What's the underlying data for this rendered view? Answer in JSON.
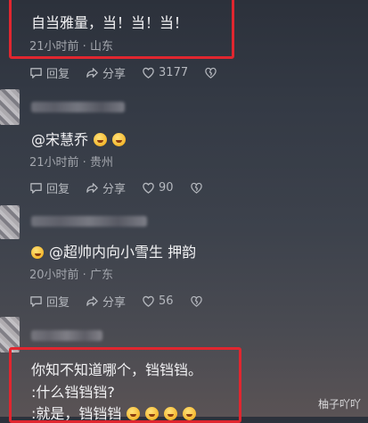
{
  "comments": [
    {
      "text": "自当雅量，当！当！当！",
      "meta": "21小时前 · 山东",
      "actions": {
        "reply": "回复",
        "share": "分享",
        "likes": "3177"
      }
    },
    {
      "text": "@宋慧乔",
      "meta": "21小时前 · 贵州",
      "actions": {
        "reply": "回复",
        "share": "分享",
        "likes": "90"
      }
    },
    {
      "text": "@超帅内向小雪生 押韵",
      "meta": "20小时前 · 广东",
      "actions": {
        "reply": "回复",
        "share": "分享",
        "likes": "56"
      }
    },
    {
      "lines": [
        "你知不知道哪个，铛铛铛。",
        ":什么铛铛铛?",
        ":就是，铛铛铛"
      ]
    }
  ],
  "watermark": "柚子吖吖",
  "colors": {
    "highlight": "#e0262f",
    "meta": "#a3a6ad"
  },
  "icons": [
    "reply-icon",
    "share-icon",
    "heart-icon",
    "broken-heart-icon",
    "laughing-emoji"
  ]
}
